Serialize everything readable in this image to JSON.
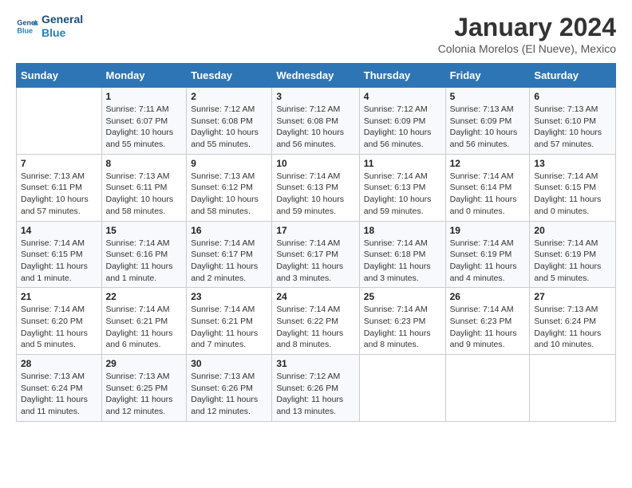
{
  "header": {
    "logo_line1": "General",
    "logo_line2": "Blue",
    "month_title": "January 2024",
    "subtitle": "Colonia Morelos (El Nueve), Mexico"
  },
  "days_of_week": [
    "Sunday",
    "Monday",
    "Tuesday",
    "Wednesday",
    "Thursday",
    "Friday",
    "Saturday"
  ],
  "weeks": [
    [
      {
        "day": "",
        "info": ""
      },
      {
        "day": "1",
        "info": "Sunrise: 7:11 AM\nSunset: 6:07 PM\nDaylight: 10 hours\nand 55 minutes."
      },
      {
        "day": "2",
        "info": "Sunrise: 7:12 AM\nSunset: 6:08 PM\nDaylight: 10 hours\nand 55 minutes."
      },
      {
        "day": "3",
        "info": "Sunrise: 7:12 AM\nSunset: 6:08 PM\nDaylight: 10 hours\nand 56 minutes."
      },
      {
        "day": "4",
        "info": "Sunrise: 7:12 AM\nSunset: 6:09 PM\nDaylight: 10 hours\nand 56 minutes."
      },
      {
        "day": "5",
        "info": "Sunrise: 7:13 AM\nSunset: 6:09 PM\nDaylight: 10 hours\nand 56 minutes."
      },
      {
        "day": "6",
        "info": "Sunrise: 7:13 AM\nSunset: 6:10 PM\nDaylight: 10 hours\nand 57 minutes."
      }
    ],
    [
      {
        "day": "7",
        "info": "Sunrise: 7:13 AM\nSunset: 6:11 PM\nDaylight: 10 hours\nand 57 minutes."
      },
      {
        "day": "8",
        "info": "Sunrise: 7:13 AM\nSunset: 6:11 PM\nDaylight: 10 hours\nand 58 minutes."
      },
      {
        "day": "9",
        "info": "Sunrise: 7:13 AM\nSunset: 6:12 PM\nDaylight: 10 hours\nand 58 minutes."
      },
      {
        "day": "10",
        "info": "Sunrise: 7:14 AM\nSunset: 6:13 PM\nDaylight: 10 hours\nand 59 minutes."
      },
      {
        "day": "11",
        "info": "Sunrise: 7:14 AM\nSunset: 6:13 PM\nDaylight: 10 hours\nand 59 minutes."
      },
      {
        "day": "12",
        "info": "Sunrise: 7:14 AM\nSunset: 6:14 PM\nDaylight: 11 hours\nand 0 minutes."
      },
      {
        "day": "13",
        "info": "Sunrise: 7:14 AM\nSunset: 6:15 PM\nDaylight: 11 hours\nand 0 minutes."
      }
    ],
    [
      {
        "day": "14",
        "info": "Sunrise: 7:14 AM\nSunset: 6:15 PM\nDaylight: 11 hours\nand 1 minute."
      },
      {
        "day": "15",
        "info": "Sunrise: 7:14 AM\nSunset: 6:16 PM\nDaylight: 11 hours\nand 1 minute."
      },
      {
        "day": "16",
        "info": "Sunrise: 7:14 AM\nSunset: 6:17 PM\nDaylight: 11 hours\nand 2 minutes."
      },
      {
        "day": "17",
        "info": "Sunrise: 7:14 AM\nSunset: 6:17 PM\nDaylight: 11 hours\nand 3 minutes."
      },
      {
        "day": "18",
        "info": "Sunrise: 7:14 AM\nSunset: 6:18 PM\nDaylight: 11 hours\nand 3 minutes."
      },
      {
        "day": "19",
        "info": "Sunrise: 7:14 AM\nSunset: 6:19 PM\nDaylight: 11 hours\nand 4 minutes."
      },
      {
        "day": "20",
        "info": "Sunrise: 7:14 AM\nSunset: 6:19 PM\nDaylight: 11 hours\nand 5 minutes."
      }
    ],
    [
      {
        "day": "21",
        "info": "Sunrise: 7:14 AM\nSunset: 6:20 PM\nDaylight: 11 hours\nand 5 minutes."
      },
      {
        "day": "22",
        "info": "Sunrise: 7:14 AM\nSunset: 6:21 PM\nDaylight: 11 hours\nand 6 minutes."
      },
      {
        "day": "23",
        "info": "Sunrise: 7:14 AM\nSunset: 6:21 PM\nDaylight: 11 hours\nand 7 minutes."
      },
      {
        "day": "24",
        "info": "Sunrise: 7:14 AM\nSunset: 6:22 PM\nDaylight: 11 hours\nand 8 minutes."
      },
      {
        "day": "25",
        "info": "Sunrise: 7:14 AM\nSunset: 6:23 PM\nDaylight: 11 hours\nand 8 minutes."
      },
      {
        "day": "26",
        "info": "Sunrise: 7:14 AM\nSunset: 6:23 PM\nDaylight: 11 hours\nand 9 minutes."
      },
      {
        "day": "27",
        "info": "Sunrise: 7:13 AM\nSunset: 6:24 PM\nDaylight: 11 hours\nand 10 minutes."
      }
    ],
    [
      {
        "day": "28",
        "info": "Sunrise: 7:13 AM\nSunset: 6:24 PM\nDaylight: 11 hours\nand 11 minutes."
      },
      {
        "day": "29",
        "info": "Sunrise: 7:13 AM\nSunset: 6:25 PM\nDaylight: 11 hours\nand 12 minutes."
      },
      {
        "day": "30",
        "info": "Sunrise: 7:13 AM\nSunset: 6:26 PM\nDaylight: 11 hours\nand 12 minutes."
      },
      {
        "day": "31",
        "info": "Sunrise: 7:12 AM\nSunset: 6:26 PM\nDaylight: 11 hours\nand 13 minutes."
      },
      {
        "day": "",
        "info": ""
      },
      {
        "day": "",
        "info": ""
      },
      {
        "day": "",
        "info": ""
      }
    ]
  ]
}
